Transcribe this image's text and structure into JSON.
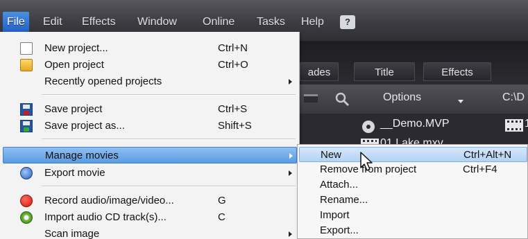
{
  "menubar": {
    "items": [
      {
        "label": "File"
      },
      {
        "label": "Edit"
      },
      {
        "label": "Effects"
      },
      {
        "label": "Window"
      },
      {
        "label": "Online"
      },
      {
        "label": "Tasks"
      },
      {
        "label": "Help"
      }
    ],
    "help_icon": "?"
  },
  "background_app": {
    "tabs": [
      {
        "label": "ades"
      },
      {
        "label": "Title"
      },
      {
        "label": "Effects"
      }
    ],
    "toolbar": {
      "options_label": "Options",
      "path": "C:\\D"
    },
    "files": [
      {
        "name": "__Demo.MVP"
      },
      {
        "name": "01 Lake.mxv"
      }
    ],
    "file_icon_text": "1"
  },
  "file_menu": {
    "items": [
      {
        "label": "New project...",
        "shortcut": "Ctrl+N",
        "icon": "document-icon"
      },
      {
        "label": "Open project",
        "shortcut": "Ctrl+O",
        "icon": "folder-icon"
      },
      {
        "label": "Recently opened projects",
        "shortcut": "",
        "submenu": true
      },
      {
        "label": "Save project",
        "shortcut": "Ctrl+S",
        "icon": "save-icon"
      },
      {
        "label": "Save project as...",
        "shortcut": "Shift+S",
        "icon": "save-as-icon"
      },
      {
        "label": "Manage movies",
        "shortcut": "",
        "submenu": true,
        "highlighted": true
      },
      {
        "label": "Export movie",
        "shortcut": "",
        "submenu": true,
        "icon": "export-icon"
      },
      {
        "label": "Record audio/image/video...",
        "shortcut": "G",
        "icon": "record-icon"
      },
      {
        "label": "Import audio CD track(s)...",
        "shortcut": "C",
        "icon": "cd-icon"
      },
      {
        "label": "Scan image",
        "shortcut": "",
        "submenu": true
      }
    ]
  },
  "manage_movies_submenu": {
    "items": [
      {
        "label": "New",
        "shortcut": "Ctrl+Alt+N",
        "highlighted": true
      },
      {
        "label": "Remove from project",
        "shortcut": "Ctrl+F4"
      },
      {
        "label": "Attach...",
        "shortcut": ""
      },
      {
        "label": "Rename...",
        "shortcut": ""
      },
      {
        "label": "Import",
        "shortcut": ""
      },
      {
        "label": "Export...",
        "shortcut": ""
      }
    ]
  },
  "colors": {
    "menubar_bg": "#3c3c42",
    "menu_highlight": "#5a9be2",
    "submenu_highlight": "#b3d2f4"
  }
}
